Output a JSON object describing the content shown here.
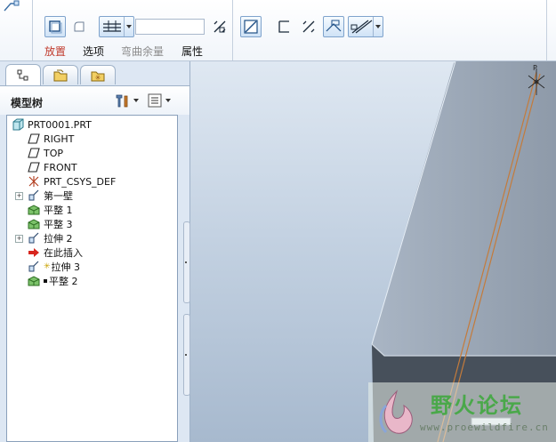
{
  "dashboard": {
    "tabs": [
      {
        "label": "放置",
        "state": "active"
      },
      {
        "label": "选项",
        "state": "normal"
      },
      {
        "label": "弯曲余量",
        "state": "disabled"
      },
      {
        "label": "属性",
        "state": "normal"
      }
    ],
    "thickness_value": "",
    "icons": [
      "sheetmetal-wall-icon",
      "cut-icon",
      "thickness-line-icon",
      "flip-thickness-icon",
      "plane-datum-icon",
      "rectangle-profile-icon",
      "flip-direction-icon",
      "relief-icon",
      "bend-relief-icon"
    ],
    "accent_color": "#c0392b"
  },
  "navigator": {
    "tabs": [
      {
        "icon": "model-tree-icon",
        "active": true
      },
      {
        "icon": "folder-browser-icon",
        "active": false
      },
      {
        "icon": "favorites-icon",
        "active": false
      }
    ]
  },
  "model_tree": {
    "title": "模型树",
    "items": [
      {
        "label": "PRT0001.PRT",
        "icon": "part-icon",
        "level": 0,
        "expandable": false
      },
      {
        "label": "RIGHT",
        "icon": "datum-plane-icon",
        "level": 1,
        "expandable": false
      },
      {
        "label": "TOP",
        "icon": "datum-plane-icon",
        "level": 1,
        "expandable": false
      },
      {
        "label": "FRONT",
        "icon": "datum-plane-icon",
        "level": 1,
        "expandable": false
      },
      {
        "label": "PRT_CSYS_DEF",
        "icon": "csys-icon",
        "level": 1,
        "expandable": false
      },
      {
        "label": "第一壁",
        "icon": "first-wall-icon",
        "level": 1,
        "expandable": true
      },
      {
        "label": "平整 1",
        "icon": "flat-wall-icon",
        "level": 1,
        "expandable": false
      },
      {
        "label": "平整 3",
        "icon": "flat-wall-icon",
        "level": 1,
        "expandable": false
      },
      {
        "label": "拉伸 2",
        "icon": "extrude-icon",
        "level": 1,
        "expandable": true
      },
      {
        "label": "在此插入",
        "icon": "insert-here-arrow-icon",
        "level": 1,
        "expandable": false
      },
      {
        "label": "拉伸 3",
        "icon": "extrude-icon",
        "level": 1,
        "expandable": false
      },
      {
        "label": "平整 2",
        "icon": "flat-wall-icon",
        "level": 1,
        "expandable": false
      }
    ]
  },
  "graphics": {
    "csys_label": "P"
  },
  "watermark": {
    "title": "野火论坛",
    "url": "www.proewildfire.cn"
  }
}
